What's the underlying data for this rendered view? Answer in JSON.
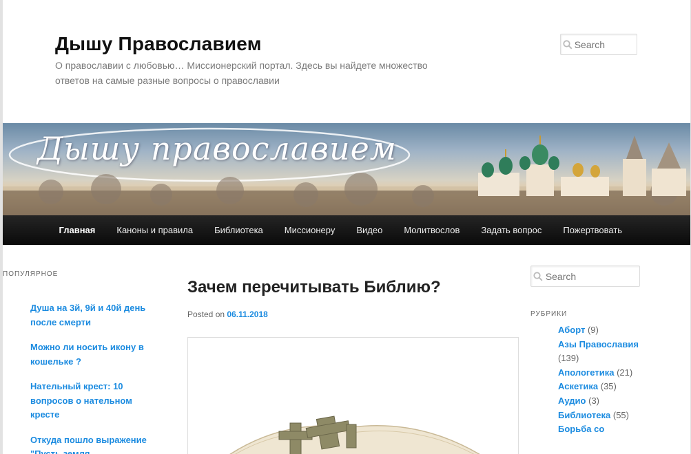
{
  "site": {
    "title": "Дышу Православием",
    "description": "О православии с любовью… Миссионерский портал. Здесь вы найдете множество ответов на самые разные вопросы о православии"
  },
  "search": {
    "placeholder": "Search"
  },
  "banner": {
    "text": "Дышу православием"
  },
  "nav": {
    "items": [
      {
        "label": "Главная",
        "current": true
      },
      {
        "label": "Каноны и правила"
      },
      {
        "label": "Библиотека"
      },
      {
        "label": "Миссионеру"
      },
      {
        "label": "Видео"
      },
      {
        "label": "Молитвослов"
      },
      {
        "label": "Задать вопрос"
      },
      {
        "label": "Пожертвовать"
      }
    ]
  },
  "popular": {
    "title": "ПОПУЛЯРНОЕ",
    "items": [
      {
        "label": "Душа на 3й, 9й и 40й день после смерти"
      },
      {
        "label": "Можно ли носить икону в кошельке ?"
      },
      {
        "label": "Нательный крест: 10 вопросов о нательном кресте"
      },
      {
        "label": "Откуда пошло выражение \"Пусть земля"
      }
    ]
  },
  "article": {
    "title": "Зачем перечитывать Библию?",
    "posted_on": "Posted on",
    "date": "06.11.2018"
  },
  "categories": {
    "title": "РУБРИКИ",
    "items": [
      {
        "label": "Аборт",
        "count": "(9)"
      },
      {
        "label": "Азы Православия",
        "count": "(139)"
      },
      {
        "label": "Апологетика",
        "count": "(21)"
      },
      {
        "label": "Аскетика",
        "count": "(35)"
      },
      {
        "label": "Аудио",
        "count": "(3)"
      },
      {
        "label": "Библиотека",
        "count": "(55)"
      },
      {
        "label": "Борьба со",
        "count": ""
      }
    ]
  },
  "colors": {
    "link": "#1b8be0",
    "nav_bg": "#111111",
    "title": "#111111"
  }
}
